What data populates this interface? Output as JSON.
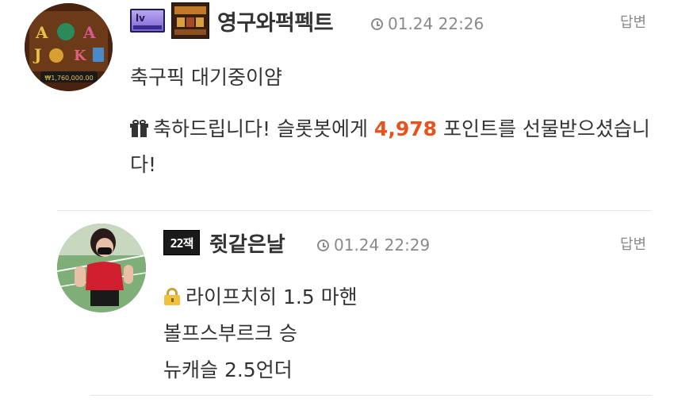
{
  "comment": {
    "author": "영구와퍽펙트",
    "level_badge": "lv",
    "time": "01.24 22:26",
    "reply_label": "답변",
    "text": "축구픽 대기중이얌",
    "gift": {
      "prefix": "축하드립니다! 슬롯봇에게 ",
      "points": "4,978",
      "suffix": " 포인트를 선물받으셨습니다!"
    },
    "avatar_caption": "₩1,760,000.00"
  },
  "reply": {
    "author": "쥣같은날",
    "emblem_text": "22잭",
    "time": "01.24 22:29",
    "reply_label": "답변",
    "lines": [
      "라이프치히 1.5 마핸",
      "볼프스부르크 승",
      "뉴캐슬 2.5언더"
    ]
  },
  "colors": {
    "points": "#e8531c",
    "meta": "#8a8a8a",
    "text": "#333333"
  }
}
